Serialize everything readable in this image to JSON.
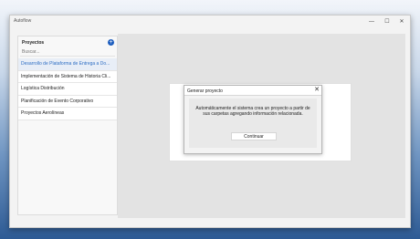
{
  "window": {
    "title": "Autoflow",
    "controls": {
      "minimize": "—",
      "maximize": "☐",
      "close": "✕"
    }
  },
  "sidebar": {
    "title": "Proyectos",
    "add_icon": "+",
    "search_placeholder": "Buscar...",
    "items": [
      {
        "label": "Desarrollo de Plataforma de Entrega a Do...",
        "selected": true
      },
      {
        "label": "Implementación de Sistema de Historia Cli...",
        "selected": false
      },
      {
        "label": "Logística Distribución",
        "selected": false
      },
      {
        "label": "Planificación de Evento Corporativo",
        "selected": false
      },
      {
        "label": "Proyectos Aerolíneas",
        "selected": false
      }
    ]
  },
  "dialog": {
    "title": "Generar proyecto",
    "close_icon": "✕",
    "message": "Automáticamente el sistema crea un proyecto a partir de sus carpetas agregando información relacionada.",
    "continue_label": "Continuar"
  }
}
